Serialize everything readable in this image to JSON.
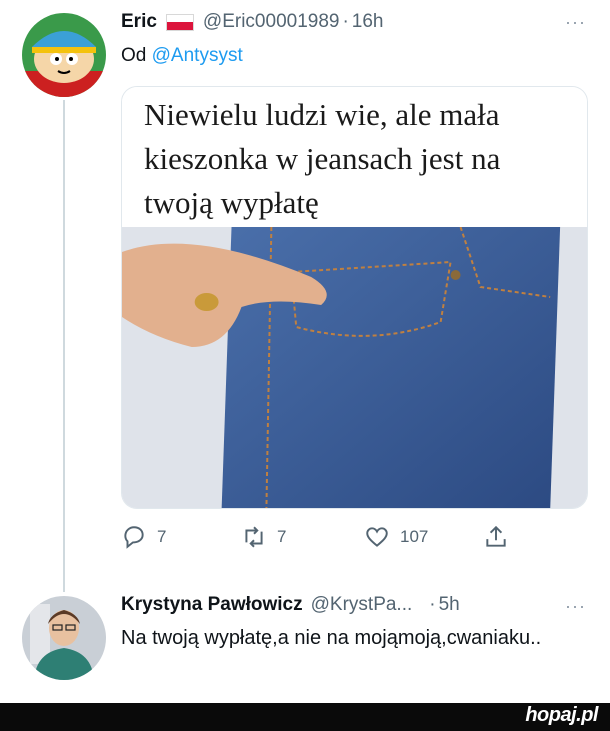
{
  "tweet": {
    "author_name": "Eric",
    "author_handle": "@Eric00001989",
    "separator": "·",
    "time": "16h",
    "more_label": "···",
    "replying_prefix": "Od",
    "replying_to": "@Antysyst",
    "image_caption": "Niewielu ludzi wie, ale mała kieszonka w jeansach jest na twoją wypłatę",
    "actions": {
      "replies": "7",
      "retweets": "7",
      "likes": "107"
    }
  },
  "reply": {
    "author_name": "Krystyna Pawłowicz",
    "author_handle": "@KrystPa...",
    "separator": "·",
    "time": "5h",
    "more_label": "···",
    "text": "Na twoją wypłatę,a nie na mojąmoją,cwaniaku.."
  },
  "footer": {
    "brand": "hopaj.pl"
  },
  "colors": {
    "accent": "#1d9bf0",
    "muted": "#536471",
    "flag_red": "#dc143c",
    "footer_bg": "#0a0a0a"
  },
  "icons": [
    "reply-icon",
    "retweet-icon",
    "like-icon",
    "share-icon",
    "more-icon",
    "poland-flag-icon"
  ]
}
